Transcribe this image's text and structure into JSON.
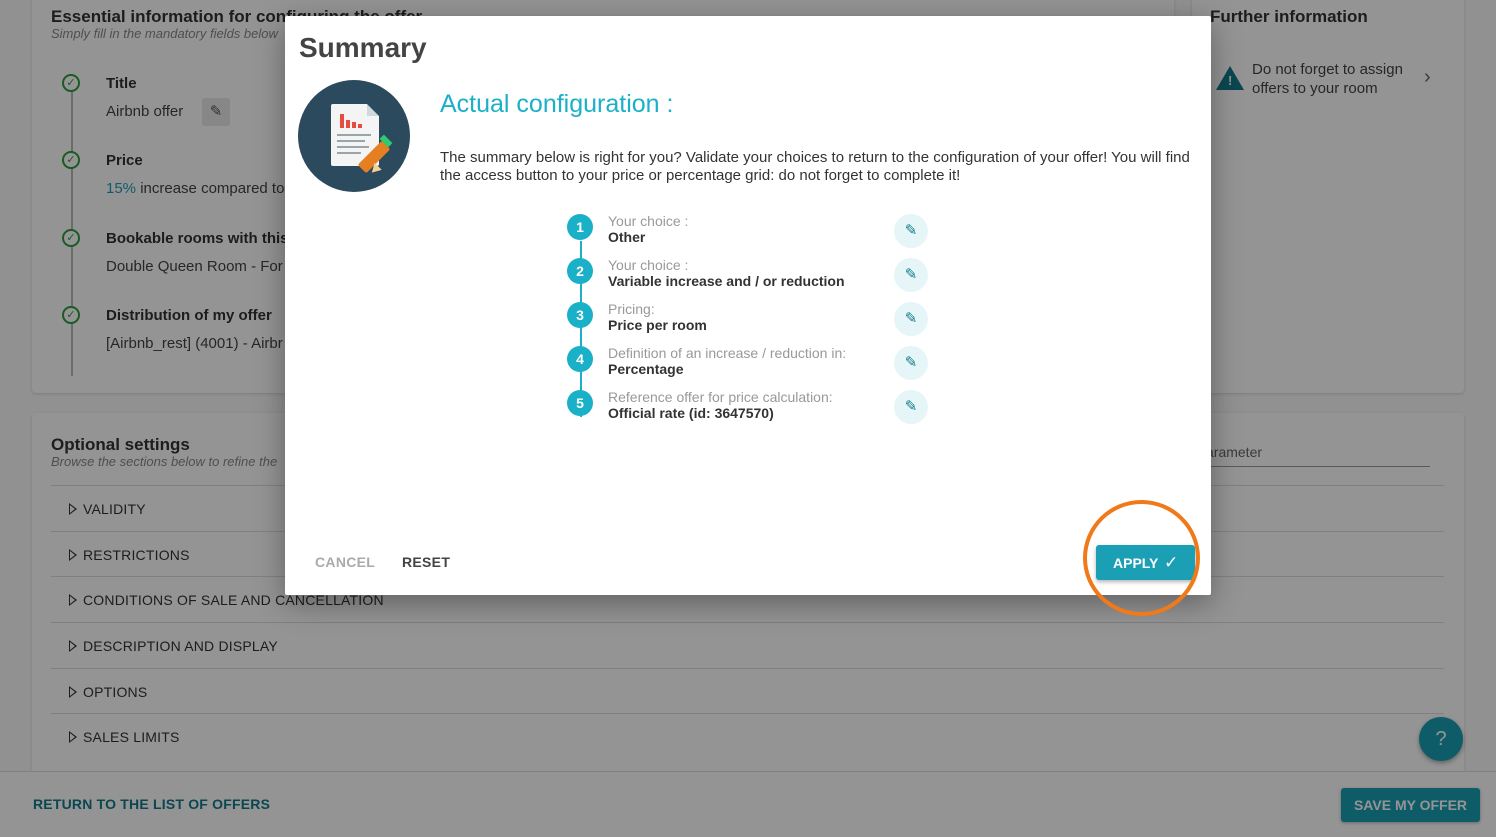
{
  "essential": {
    "title": "Essential information for configuring the offer",
    "subtitle": "Simply fill in the mandatory fields below",
    "steps": [
      {
        "title": "Title",
        "value": "Airbnb offer"
      },
      {
        "title": "Price",
        "value_accent": "15%",
        "value": " increase compared to"
      },
      {
        "title": "Bookable rooms with this",
        "value": "Double Queen Room - For"
      },
      {
        "title": "Distribution of my offer",
        "value": "[Airbnb_rest] (4001) - Airbr"
      }
    ]
  },
  "further": {
    "title": "Further information",
    "warning": "Do not forget to assign offers to your room"
  },
  "optional": {
    "title": "Optional settings",
    "subtitle": "Browse the sections below to refine the",
    "search_placeholder": "arameter",
    "sections": [
      "VALIDITY",
      "RESTRICTIONS",
      "CONDITIONS OF SALE AND CANCELLATION",
      "DESCRIPTION AND DISPLAY",
      "OPTIONS",
      "SALES LIMITS"
    ]
  },
  "footer": {
    "return_label": "RETURN TO THE LIST OF OFFERS",
    "save_label": "SAVE MY OFFER"
  },
  "help_label": "?",
  "modal": {
    "title": "Summary",
    "heading": "Actual configuration :",
    "description": "The summary below is right for you? Validate your choices to return to the configuration of your offer! You will find the access button to your price or percentage grid: do not forget to complete it!",
    "steps": [
      {
        "num": "1",
        "label": "Your choice :",
        "value": "Other"
      },
      {
        "num": "2",
        "label": "Your choice :",
        "value": "Variable increase and / or reduction"
      },
      {
        "num": "3",
        "label": "Pricing:",
        "value": "Price per room"
      },
      {
        "num": "4",
        "label": "Definition of an increase / reduction in:",
        "value": "Percentage"
      },
      {
        "num": "5",
        "label": "Reference offer for price calculation:",
        "value": "Official rate (id: 3647570)"
      }
    ],
    "cancel_label": "CANCEL",
    "reset_label": "RESET",
    "apply_label": "APPLY"
  },
  "colors": {
    "accent": "#1a9fb5",
    "highlight": "#f07a1a",
    "check": "#2e9e3e"
  }
}
